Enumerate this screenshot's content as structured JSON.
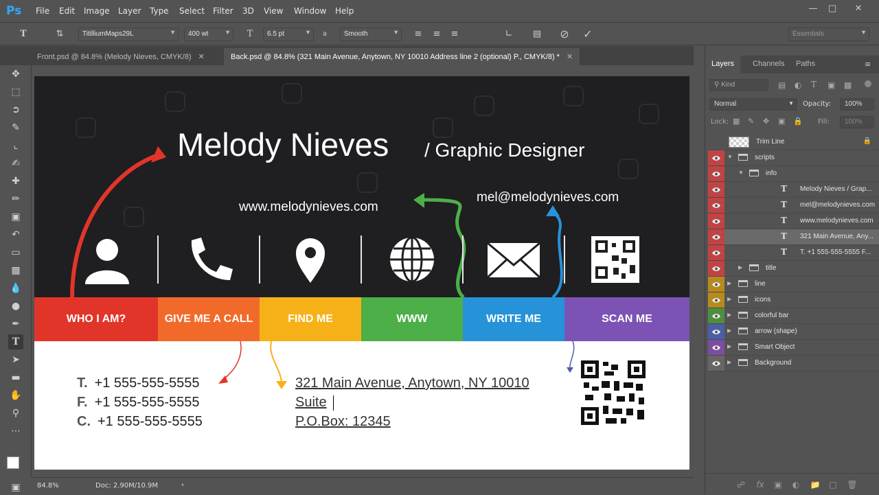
{
  "app": {
    "logo": "Ps"
  },
  "menu": [
    "File",
    "Edit",
    "Image",
    "Layer",
    "Type",
    "Select",
    "Filter",
    "3D",
    "View",
    "Window",
    "Help"
  ],
  "options": {
    "font_family": "TitilliumMaps29L",
    "font_style": "400 wt",
    "font_size": "6.5 pt",
    "antialias": "Smooth",
    "workspace": "Essentials"
  },
  "tabs": [
    {
      "label": "Front.psd @ 84.8% (Melody Nieves, CMYK/8)",
      "active": false
    },
    {
      "label": "Back.psd @ 84.8% (321 Main Avenue, Anytown, NY 10010 Address line 2 (optional) P., CMYK/8) *",
      "active": true
    }
  ],
  "card": {
    "name": "Melody Nieves",
    "role": "/ Graphic Designer",
    "website": "www.melodynieves.com",
    "email": "mel@melodynieves.com",
    "bands": [
      {
        "label": "WHO I AM?",
        "color": "#e2352a"
      },
      {
        "label": "GIVE ME A CALL",
        "color": "#f26a2a"
      },
      {
        "label": "FIND ME",
        "color": "#f7b118"
      },
      {
        "label": "WWW",
        "color": "#4caf48"
      },
      {
        "label": "WRITE ME",
        "color": "#2693d9"
      },
      {
        "label": "SCAN ME",
        "color": "#7c53b4"
      }
    ],
    "phones": [
      {
        "key": "T.",
        "value": "+1 555-555-5555"
      },
      {
        "key": "F.",
        "value": "+1 555-555-5555"
      },
      {
        "key": "C.",
        "value": "+1 555-555-5555"
      }
    ],
    "address": [
      "321 Main Avenue, Anytown, NY 10010",
      "Suite",
      "P.O.Box: 12345"
    ]
  },
  "status": {
    "zoom": "84.8%",
    "doc": "Doc: 2.90M/10.9M"
  },
  "layers_panel": {
    "tabs": [
      "Layers",
      "Channels",
      "Paths"
    ],
    "filter_placeholder": "Kind",
    "blend_mode": "Normal",
    "opacity_label": "Opacity:",
    "opacity": "100%",
    "lock_label": "Lock:",
    "fill_label": "Fill:",
    "fill": "100%",
    "layers": [
      {
        "name": "Trim Line",
        "kind": "pixel",
        "depth": 0,
        "eye": false,
        "color": "",
        "locked": true
      },
      {
        "name": "scripts",
        "kind": "group",
        "depth": 0,
        "eye": true,
        "color": "#c04444",
        "expanded": true
      },
      {
        "name": "info",
        "kind": "group",
        "depth": 1,
        "eye": true,
        "color": "#c04444",
        "expanded": true
      },
      {
        "name": "Melody Nieves / Grap...",
        "kind": "text",
        "depth": 2,
        "eye": true,
        "color": "#c04444"
      },
      {
        "name": "mel@melodynieves.com",
        "kind": "text",
        "depth": 2,
        "eye": true,
        "color": "#c04444"
      },
      {
        "name": "www.melodynieves.com",
        "kind": "text",
        "depth": 2,
        "eye": true,
        "color": "#c04444"
      },
      {
        "name": "321 Main Avenue, Any...",
        "kind": "text",
        "depth": 2,
        "eye": true,
        "color": "#c04444",
        "selected": true
      },
      {
        "name": "T. +1 555-555-5555 F...",
        "kind": "text",
        "depth": 2,
        "eye": true,
        "color": "#c04444"
      },
      {
        "name": "title",
        "kind": "group",
        "depth": 1,
        "eye": true,
        "color": "#c04444"
      },
      {
        "name": "line",
        "kind": "group",
        "depth": 0,
        "eye": true,
        "color": "#b88a1e"
      },
      {
        "name": "icons",
        "kind": "group",
        "depth": 0,
        "eye": true,
        "color": "#b88a1e"
      },
      {
        "name": "colorful bar",
        "kind": "group",
        "depth": 0,
        "eye": true,
        "color": "#4e8f3f"
      },
      {
        "name": "arrow (shape)",
        "kind": "group",
        "depth": 0,
        "eye": true,
        "color": "#4b5ea8"
      },
      {
        "name": "Smart Object",
        "kind": "group",
        "depth": 0,
        "eye": true,
        "color": "#7b4ea0"
      },
      {
        "name": "Background",
        "kind": "group",
        "depth": 0,
        "eye": true,
        "color": "#666666"
      }
    ]
  }
}
